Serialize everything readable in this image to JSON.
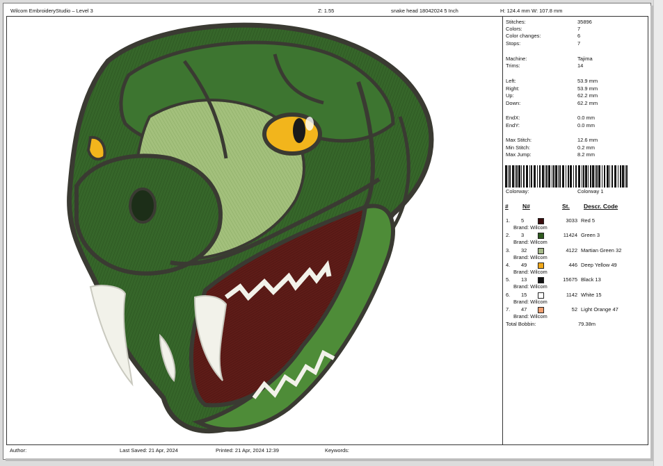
{
  "header": {
    "app_title": "Wilcom EmbroideryStudio – Level 3",
    "zoom": "Z: 1.55",
    "file_name": "snake head 18042024 5 Inch",
    "dimensions": "H: 124.4 mm  W: 107.8 mm"
  },
  "stats": {
    "stitches_label": "Stitches:",
    "stitches": "35896",
    "colors_label": "Colors:",
    "colors": "7",
    "color_changes_label": "Color changes:",
    "color_changes": "6",
    "stops_label": "Stops:",
    "stops": "7",
    "machine_label": "Machine:",
    "machine": "Tajima",
    "trims_label": "Trims:",
    "trims": "14",
    "left_label": "Left:",
    "left": "53.9 mm",
    "right_label": "Right:",
    "right": "53.9 mm",
    "up_label": "Up:",
    "up": "62.2 mm",
    "down_label": "Down:",
    "down": "62.2 mm",
    "endx_label": "EndX:",
    "endx": "0.0 mm",
    "endy_label": "EndY:",
    "endy": "0.0 mm",
    "max_stitch_label": "Max Stitch:",
    "max_stitch": "12.6 mm",
    "min_stitch_label": "Min Stitch:",
    "min_stitch": "0.2 mm",
    "max_jump_label": "Max Jump:",
    "max_jump": "8.2 mm",
    "colorway_label": "Colorway:",
    "colorway": "Colorway 1"
  },
  "color_table": {
    "headers": {
      "num": "#",
      "n": "N#",
      "st": "St.",
      "descr": "Descr. Code"
    },
    "brand_label": "Brand: Wilcom",
    "rows": [
      {
        "idx": "1.",
        "n": "5",
        "st": "3033",
        "descr": "Red 5",
        "color": "#3a0c0c"
      },
      {
        "idx": "2.",
        "n": "3",
        "st": "11424",
        "descr": "Green 3",
        "color": "#2e5a1e"
      },
      {
        "idx": "3.",
        "n": "32",
        "st": "4122",
        "descr": "Martian Green 32",
        "color": "#a6b98a"
      },
      {
        "idx": "4.",
        "n": "49",
        "st": "446",
        "descr": "Deep Yellow 49",
        "color": "#f0a81a"
      },
      {
        "idx": "5.",
        "n": "13",
        "st": "15675",
        "descr": "Black 13",
        "color": "#141414"
      },
      {
        "idx": "6.",
        "n": "15",
        "st": "1142",
        "descr": "White 15",
        "color": "#ffffff"
      },
      {
        "idx": "7.",
        "n": "47",
        "st": "52",
        "descr": "Light Orange 47",
        "color": "#f0a070"
      }
    ],
    "total_bobbin_label": "Total Bobbin:",
    "total_bobbin": "79.38m"
  },
  "footer": {
    "author_label": "Author:",
    "last_saved": "Last Saved: 21 Apr, 2024",
    "printed": "Printed: 21 Apr, 2024 12:39",
    "keywords_label": "Keywords:"
  },
  "design": {
    "name": "snake-head-embroidery",
    "colors": {
      "dark_green": "#2f5a22",
      "mid_green": "#3f7a2c",
      "light_green": "#9fbf78",
      "outline": "#3a3a32",
      "mouth": "#5e1c18",
      "fang": "#f2f2ea",
      "eye": "#f2b51c"
    }
  }
}
